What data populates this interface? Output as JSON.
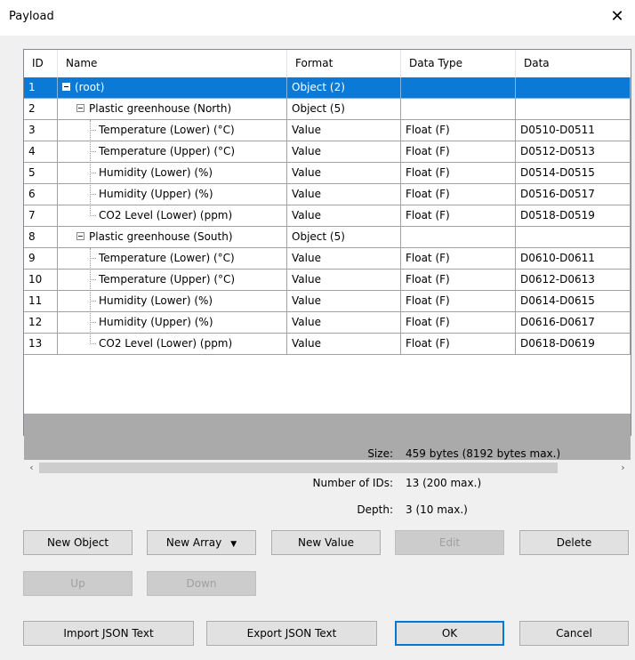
{
  "window": {
    "title": "Payload",
    "close_glyph": "✕"
  },
  "grid": {
    "columns": [
      "ID",
      "Name",
      "Format",
      "Data Type",
      "Data"
    ],
    "rows": [
      {
        "id": "1",
        "name": "(root)",
        "format": "Object (2)",
        "type": "",
        "data": "",
        "level": 0,
        "expander": true,
        "selected": true
      },
      {
        "id": "2",
        "name": "Plastic greenhouse (North)",
        "format": "Object (5)",
        "type": "",
        "data": "",
        "level": 1,
        "expander": true
      },
      {
        "id": "3",
        "name": "Temperature (Lower) (°C)",
        "format": "Value",
        "type": "Float (F)",
        "data": "D0510-D0511",
        "level": 2
      },
      {
        "id": "4",
        "name": "Temperature (Upper) (°C)",
        "format": "Value",
        "type": "Float (F)",
        "data": "D0512-D0513",
        "level": 2
      },
      {
        "id": "5",
        "name": "Humidity (Lower) (%)",
        "format": "Value",
        "type": "Float (F)",
        "data": "D0514-D0515",
        "level": 2
      },
      {
        "id": "6",
        "name": "Humidity (Upper) (%)",
        "format": "Value",
        "type": "Float (F)",
        "data": "D0516-D0517",
        "level": 2
      },
      {
        "id": "7",
        "name": "CO2 Level (Lower) (ppm)",
        "format": "Value",
        "type": "Float (F)",
        "data": "D0518-D0519",
        "level": 2
      },
      {
        "id": "8",
        "name": "Plastic greenhouse (South)",
        "format": "Object (5)",
        "type": "",
        "data": "",
        "level": 1,
        "expander": true
      },
      {
        "id": "9",
        "name": "Temperature (Lower) (°C)",
        "format": "Value",
        "type": "Float (F)",
        "data": "D0610-D0611",
        "level": 2
      },
      {
        "id": "10",
        "name": "Temperature (Upper) (°C)",
        "format": "Value",
        "type": "Float (F)",
        "data": "D0612-D0613",
        "level": 2
      },
      {
        "id": "11",
        "name": "Humidity (Lower) (%)",
        "format": "Value",
        "type": "Float (F)",
        "data": "D0614-D0615",
        "level": 2
      },
      {
        "id": "12",
        "name": "Humidity (Upper) (%)",
        "format": "Value",
        "type": "Float (F)",
        "data": "D0616-D0617",
        "level": 2
      },
      {
        "id": "13",
        "name": "CO2 Level (Lower) (ppm)",
        "format": "Value",
        "type": "Float (F)",
        "data": "D0618-D0619",
        "level": 2
      }
    ]
  },
  "scroll": {
    "left_glyph": "‹",
    "right_glyph": "›"
  },
  "info": {
    "size_label": "Size:",
    "size_value": "459 bytes (8192 bytes max.)",
    "ids_label": "Number of IDs:",
    "ids_value": "13 (200 max.)",
    "depth_label": "Depth:",
    "depth_value": "3 (10 max.)"
  },
  "buttons": {
    "new_object": "New Object",
    "new_array": "New Array",
    "new_array_arrow": "▼",
    "new_value": "New Value",
    "edit": "Edit",
    "delete": "Delete",
    "up": "Up",
    "down": "Down",
    "import": "Import JSON Text",
    "export": "Export JSON Text",
    "ok": "OK",
    "cancel": "Cancel"
  }
}
